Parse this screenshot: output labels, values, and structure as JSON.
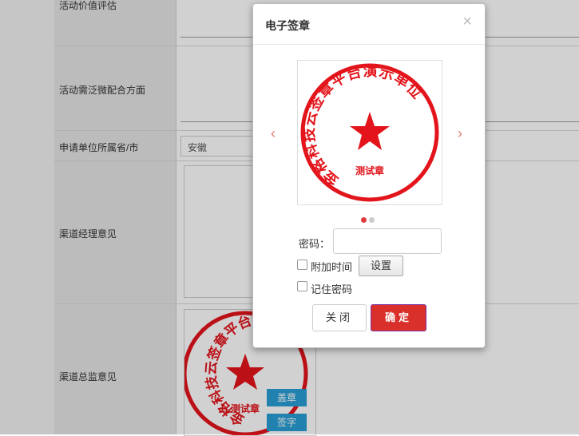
{
  "form": {
    "rows": [
      {
        "label": "活动价值评估"
      },
      {
        "label": "活动需泛微配合方面"
      },
      {
        "label": "申请单位所属省/市"
      },
      {
        "label": "渠道经理意见"
      },
      {
        "label": "渠道总监意见"
      }
    ],
    "province_value": "安徽",
    "sign_buttons": {
      "seal": "盖章",
      "sign": "签字"
    }
  },
  "stamp": {
    "ring_text": "金格科技云签章平台演示单位",
    "center_text": "测试章",
    "color": "#e3141b"
  },
  "modal": {
    "title": "电子签章",
    "close_icon": "×",
    "prev_arrow": "‹",
    "next_arrow": "›",
    "password_label": "密码：",
    "password_value": "",
    "add_time_label": "附加时间",
    "settings_label": "设置",
    "remember_label": "记住密码",
    "close_label": "关闭",
    "ok_label": "确定",
    "carousel": {
      "count": 2,
      "active": 0
    }
  }
}
